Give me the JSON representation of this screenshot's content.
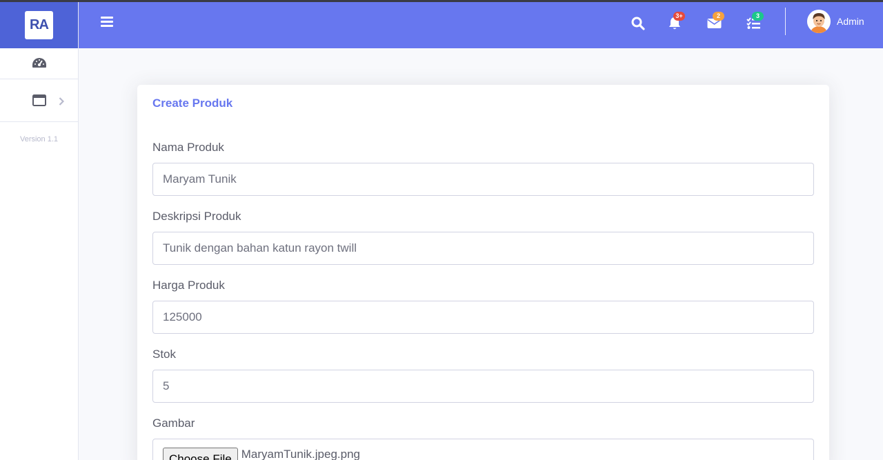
{
  "brand": {
    "logo_text": "RA"
  },
  "sidebar": {
    "items": [
      {
        "icon": "dashboard-icon"
      },
      {
        "icon": "window-icon",
        "has_chevron": true
      }
    ],
    "version": "Version 1.1"
  },
  "topbar": {
    "notifications_badge": "3+",
    "messages_badge": "2",
    "tasks_badge": "3",
    "user_name": "Admin",
    "colors": {
      "bar": "#6777ef",
      "brand": "#4e63d7"
    }
  },
  "form": {
    "title": "Create Produk",
    "fields": [
      {
        "label": "Nama Produk",
        "value": "Maryam Tunik"
      },
      {
        "label": "Deskripsi Produk",
        "value": "Tunik dengan bahan katun rayon twill"
      },
      {
        "label": "Harga Produk",
        "value": "125000"
      },
      {
        "label": "Stok",
        "value": "5"
      }
    ],
    "image_field": {
      "label": "Gambar",
      "button": "Choose File",
      "file_name": "MaryamTunik.jpeg.png"
    }
  }
}
